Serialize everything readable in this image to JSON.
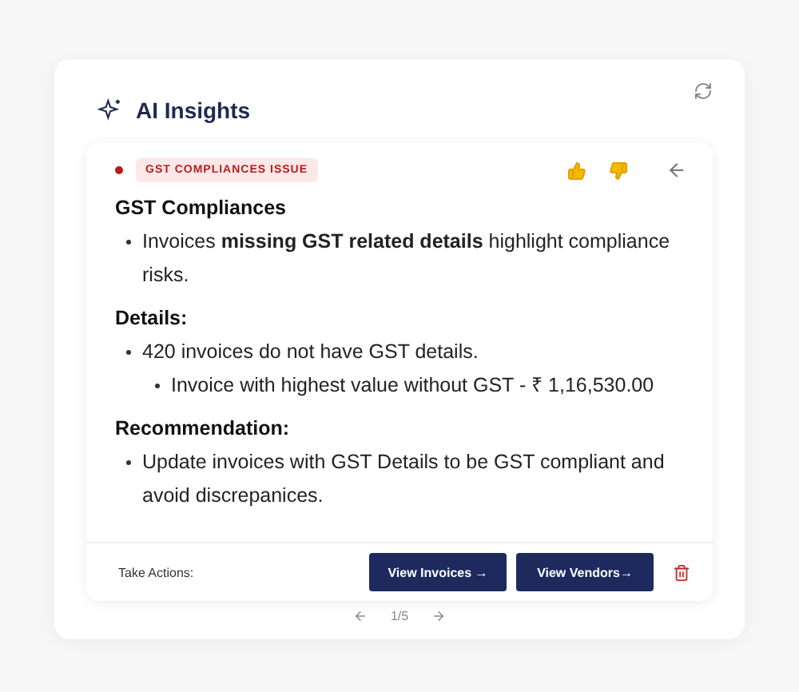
{
  "header": {
    "title": "AI Insights"
  },
  "insight": {
    "tag": "GST COMPLIANCES ISSUE",
    "sections": [
      {
        "heading": "GST Compliances",
        "items": [
          {
            "text": "Invoices **missing GST related details** highlight compliance risks."
          }
        ]
      },
      {
        "heading": "Details:",
        "items": [
          {
            "text": "420 invoices do not have GST details.",
            "children": [
              {
                "text": "Invoice with highest value without GST - ₹ 1,16,530.00"
              }
            ]
          }
        ]
      },
      {
        "heading": "Recommendation:",
        "items": [
          {
            "text": "Update invoices with GST Details to be GST compliant and avoid discrepanices."
          }
        ]
      }
    ]
  },
  "actions": {
    "label": "Take Actions:",
    "buttons": [
      "View Invoices →",
      "View Vendors→"
    ]
  },
  "pager": {
    "text": "1/5"
  }
}
